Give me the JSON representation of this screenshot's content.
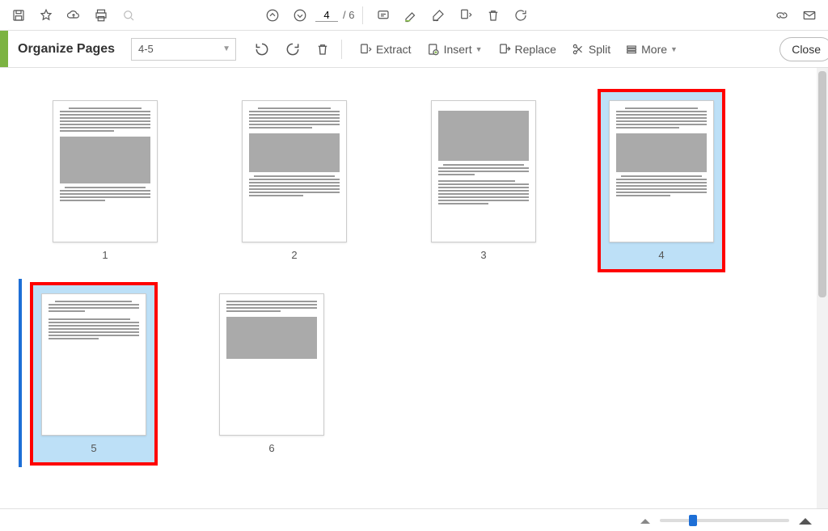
{
  "top_toolbar": {
    "page_current": "4",
    "page_total": "/ 6"
  },
  "sub_toolbar": {
    "title": "Organize Pages",
    "range": "4-5",
    "extract": "Extract",
    "insert": "Insert",
    "replace": "Replace",
    "split": "Split",
    "more": "More",
    "close": "Close"
  },
  "pages": {
    "p1": "1",
    "p2": "2",
    "p3": "3",
    "p4": "4",
    "p5": "5",
    "p6": "6"
  }
}
